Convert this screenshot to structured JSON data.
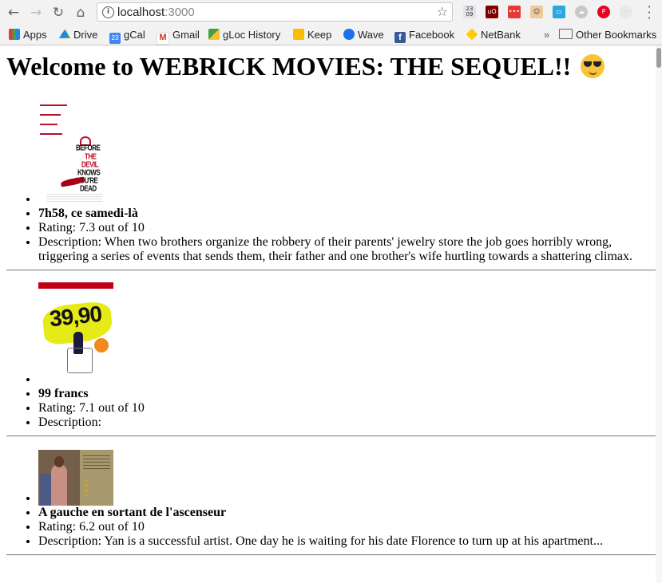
{
  "browser": {
    "url_host": "localhost",
    "url_port": ":3000",
    "bookmarks": [
      "Apps",
      "Drive",
      "gCal",
      "Gmail",
      "gLoc History",
      "Keep",
      "Wave",
      "Facebook",
      "NetBank"
    ],
    "overflow_label": "»",
    "other_bookmarks": "Other Bookmarks",
    "gcal_icon_text": "23",
    "calendar_ext_text": "23 09"
  },
  "page": {
    "heading": "Welcome to WEBRICK MOVIES: THE SEQUEL!!",
    "movies": [
      {
        "title": "7h58, ce samedi-là",
        "rating": "Rating: 7.3 out of 10",
        "description": "Description: When two brothers organize the robbery of their parents' jewelry store the job goes horribly wrong, triggering a series of events that sends them, their father and one brother's wife hurtling towards a shattering climax.",
        "poster_text": [
          "BEFORE",
          "THE",
          "DEVIL",
          "KNOWS",
          "YOU'RE",
          "DEAD"
        ]
      },
      {
        "title": "99 francs",
        "rating": "Rating: 7.1 out of 10",
        "description": "Description:",
        "poster_text": [
          "39,90"
        ]
      },
      {
        "title": "A gauche en sortant de l'ascenseur",
        "rating": "Rating: 6.2 out of 10",
        "description": "Description: Yan is a successful artist. One day he is waiting for his date Florence to turn up at his apartment...",
        "poster_text": []
      }
    ]
  },
  "colors": {
    "chrome_bg": "#f2f2f2",
    "poster_red": "#b8102a",
    "poster_yellow": "#e6ea17"
  }
}
